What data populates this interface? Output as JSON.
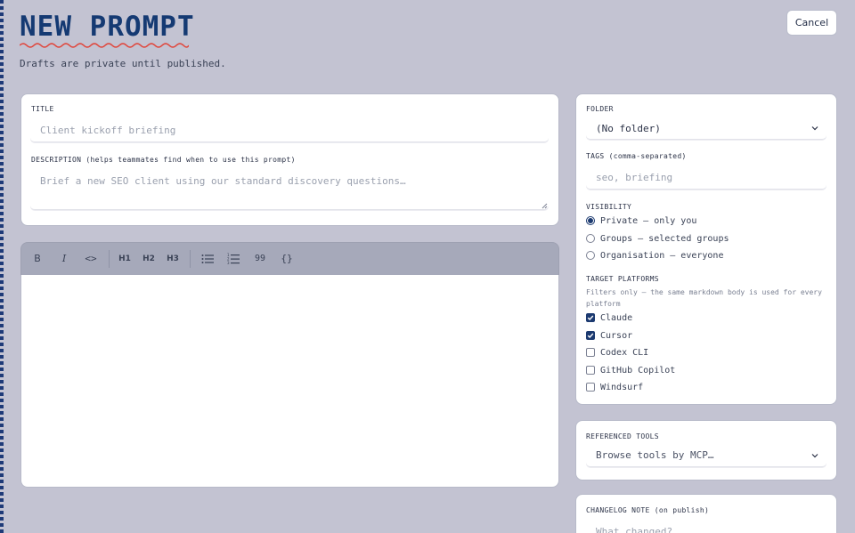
{
  "header": {
    "title": "NEW PROMPT",
    "subtitle": "Drafts are private until published.",
    "cancel_label": "Cancel"
  },
  "details": {
    "title_label": "TITLE",
    "title_placeholder": "Client kickoff briefing",
    "description_label": "DESCRIPTION (helps teammates find when to use this prompt)",
    "description_placeholder": "Brief a new SEO client using our standard discovery questions…"
  },
  "toolbar": {
    "bold": "B",
    "italic": "I",
    "code": "<>",
    "h1": "H1",
    "h2": "H2",
    "h3": "H3",
    "quote": "99",
    "variable": "{}"
  },
  "settings": {
    "folder_label": "FOLDER",
    "folder_value": "(No folder)",
    "tags_label": "TAGS (comma-separated)",
    "tags_placeholder": "seo, briefing",
    "visibility_label": "VISIBILITY",
    "visibility_options": [
      {
        "label": "Private — only you",
        "selected": true
      },
      {
        "label": "Groups — selected groups",
        "selected": false
      },
      {
        "label": "Organisation — everyone",
        "selected": false
      }
    ],
    "platforms_label": "TARGET PLATFORMS",
    "platforms_hint_1": "Filters only — the same markdown body is used for every",
    "platforms_hint_2": "platform",
    "platforms": [
      {
        "label": "Claude",
        "checked": true
      },
      {
        "label": "Cursor",
        "checked": true
      },
      {
        "label": "Codex CLI",
        "checked": false
      },
      {
        "label": "GitHub Copilot",
        "checked": false
      },
      {
        "label": "Windsurf",
        "checked": false
      }
    ]
  },
  "tools": {
    "label": "REFERENCED TOOLS",
    "placeholder": "Browse tools by MCP…"
  },
  "changelog": {
    "label": "CHANGELOG NOTE (on publish)",
    "placeholder": "What changed?"
  },
  "colors": {
    "background": "#c3c3d2",
    "accent": "#153a73",
    "squiggle": "#e0463c",
    "toolbar": "#a6a9ba"
  }
}
